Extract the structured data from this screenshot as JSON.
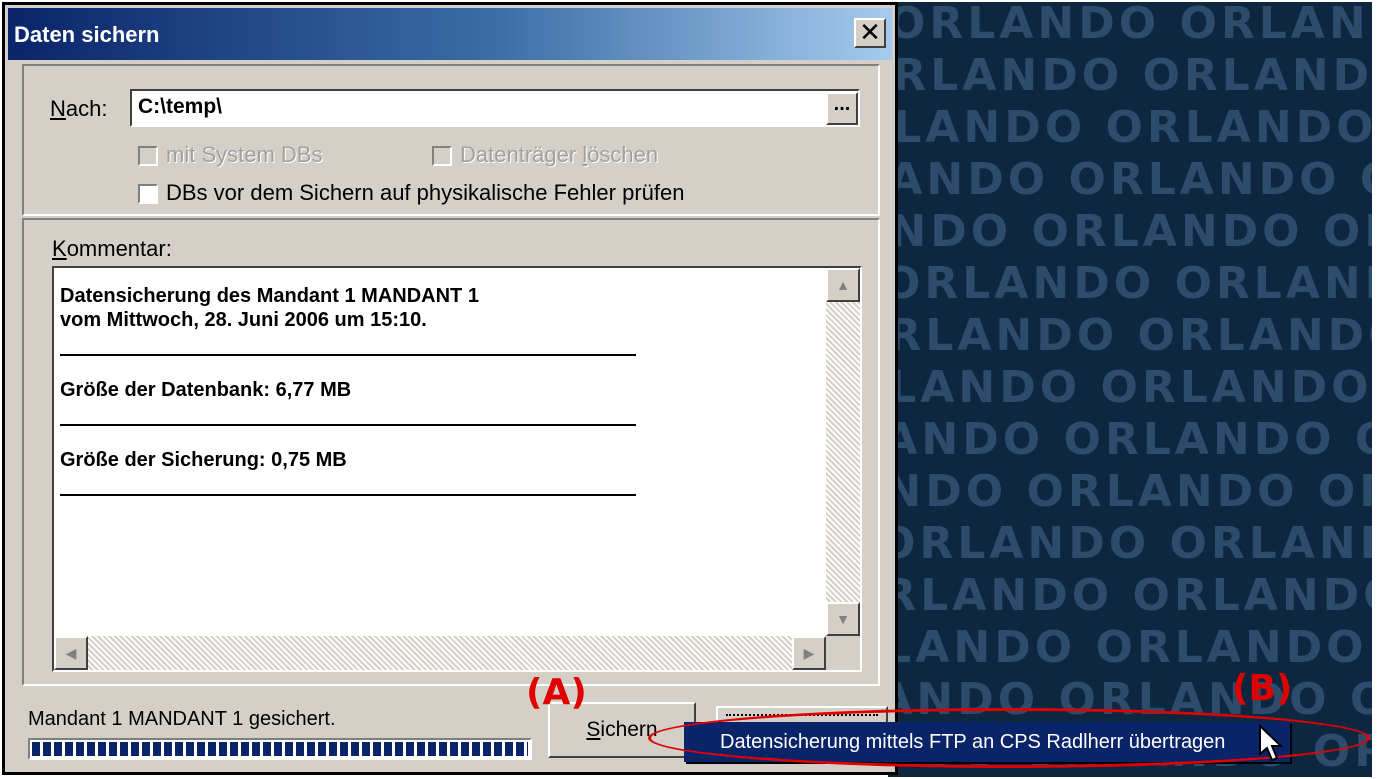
{
  "dialog": {
    "title": "Daten sichern",
    "close_glyph": "✕",
    "nach_label_u": "N",
    "nach_label_rest": "ach:",
    "nach_value": "C:\\temp\\",
    "browse_label": "...",
    "checkbox_system_dbs": "mit System DBs",
    "checkbox_datentraeger_pre": "Datenträger ",
    "checkbox_datentraeger_u": "l",
    "checkbox_datentraeger_post": "öschen",
    "checkbox_pruefen": "DBs vor dem Sichern auf physikalische Fehler prüfen",
    "kommentar_label_u": "K",
    "kommentar_label_rest": "ommentar:",
    "comment_lines": [
      "Datensicherung des Mandant 1 MANDANT 1",
      "vom Mittwoch, 28. Juni 2006 um 15:10.",
      "Größe der Datenbank: 6,77 MB",
      "Größe der Sicherung: 0,75 MB"
    ],
    "status_text": "Mandant 1 MANDANT 1 gesichert.",
    "progress": 1.0,
    "sichern_u": "S",
    "sichern_rest": "ichern"
  },
  "menu": {
    "item": "Datensicherung mittels FTP an CPS Radlherr übertragen"
  },
  "annotations": {
    "a": "(A)",
    "b": "(B)",
    "color": "#e00000"
  },
  "background": {
    "pattern_text": "ORLANDO",
    "color": "#0d2740"
  }
}
